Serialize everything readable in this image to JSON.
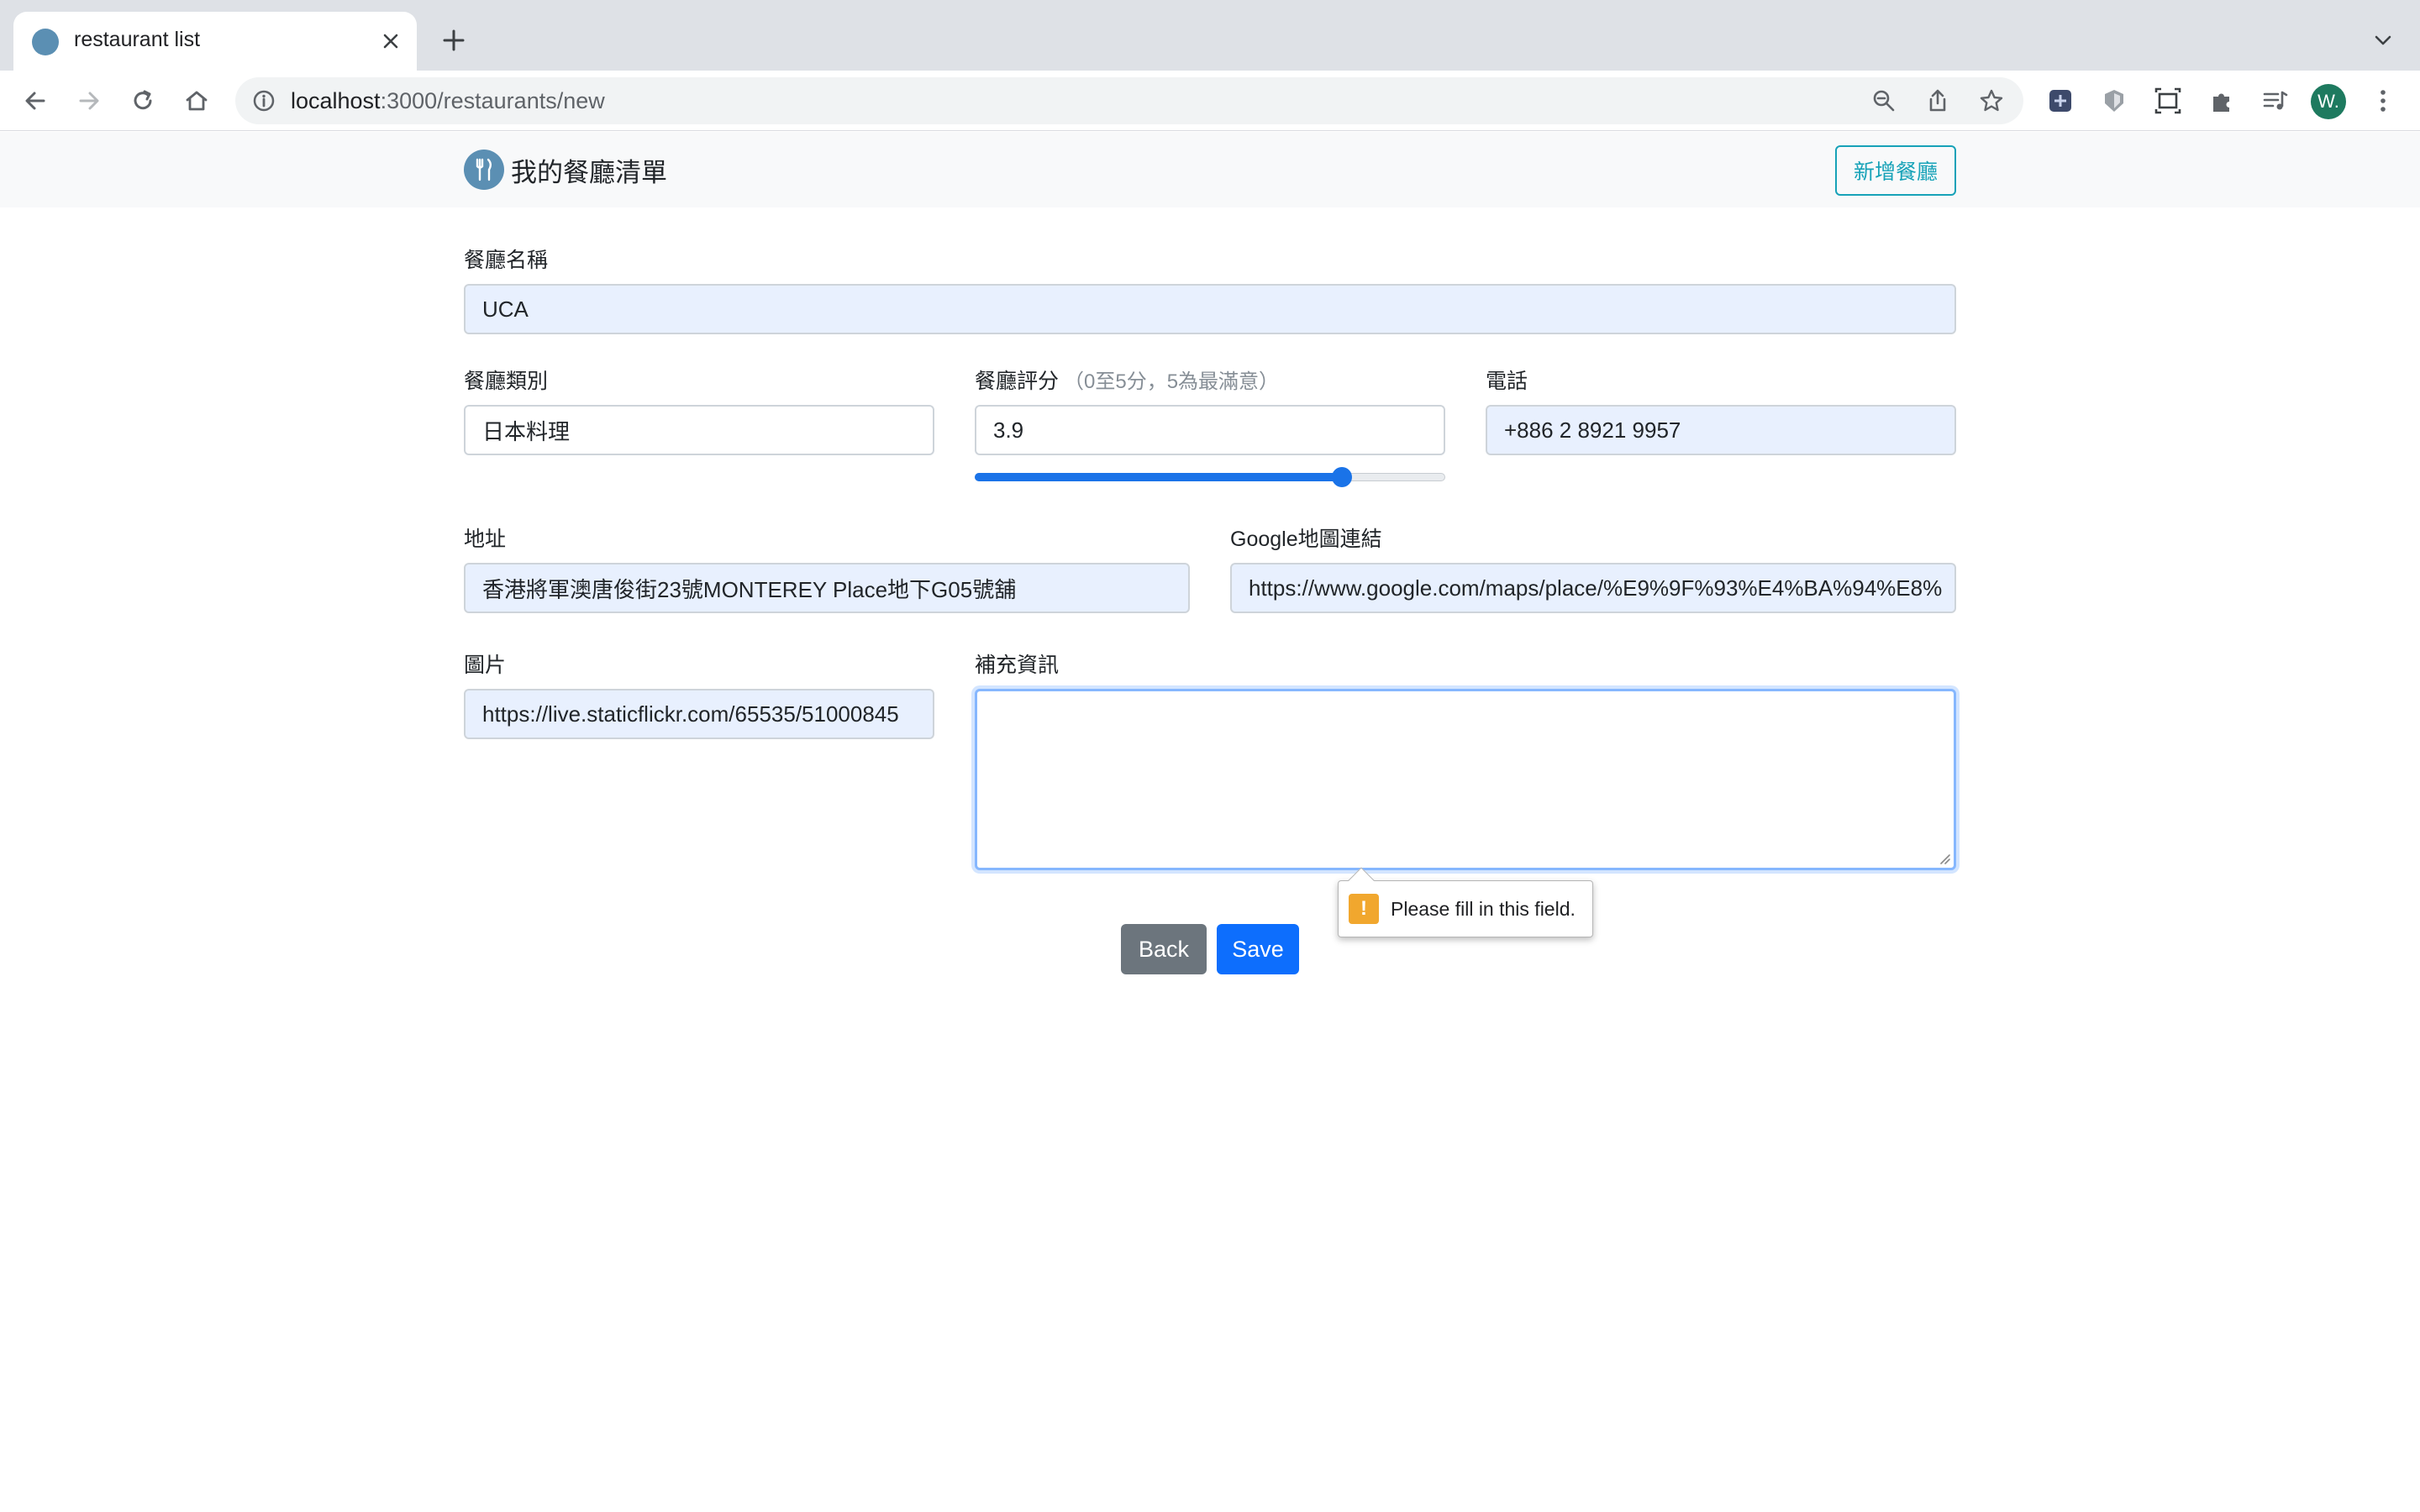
{
  "browser": {
    "tab_title": "restaurant list",
    "url_host": "localhost",
    "url_path": ":3000/restaurants/new",
    "profile_initial": "W."
  },
  "navbar": {
    "brand": "我的餐廳清單",
    "new_button": "新增餐廳"
  },
  "form": {
    "name": {
      "label": "餐廳名稱",
      "value": "UCA"
    },
    "category": {
      "label": "餐廳類別",
      "value": "日本料理"
    },
    "rating": {
      "label": "餐廳評分",
      "hint": "（0至5分，5為最滿意）",
      "value": "3.9",
      "min": 0,
      "max": 5
    },
    "phone": {
      "label": "電話",
      "value": "+886 2 8921 9957"
    },
    "location": {
      "label": "地址",
      "value": "香港將軍澳唐俊街23號MONTEREY Place地下G05號舖"
    },
    "google_map": {
      "label": "Google地圖連結",
      "value": "https://www.google.com/maps/place/%E9%9F%93%E4%BA%94%E8%"
    },
    "image": {
      "label": "圖片",
      "value": "https://live.staticflickr.com/65535/51000845"
    },
    "description": {
      "label": "補充資訊",
      "value": ""
    }
  },
  "validation_message": "Please fill in this field.",
  "buttons": {
    "back": "Back",
    "save": "Save"
  },
  "colors": {
    "accent": "#17a2b8",
    "primary": "#0d6efd",
    "secondary": "#6c757d",
    "autofill": "#e8f0fe",
    "warning": "#f1a72e"
  }
}
